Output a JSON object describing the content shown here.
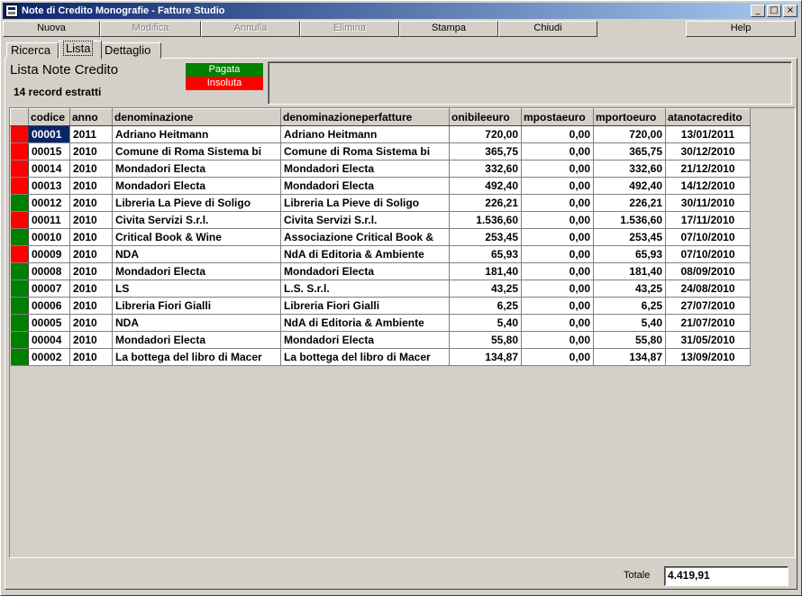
{
  "window": {
    "title": "Note di Credito Monografie - Fatture Studio"
  },
  "toolbar": {
    "nuova": "Nuova",
    "modifica": "Modifica",
    "annulla": "Annulla",
    "elimina": "Elimina",
    "stampa": "Stampa",
    "chiudi": "Chiudi",
    "help": "Help"
  },
  "tabs": [
    "Ricerca",
    "Lista",
    "Dettaglio"
  ],
  "list": {
    "title": "Lista Note Credito",
    "record_count": "14 record estratti"
  },
  "legend": {
    "paid": "Pagata",
    "unpaid": "Insoluta",
    "paid_color": "#008000",
    "unpaid_color": "#ff0000"
  },
  "columns": [
    "codice",
    "anno",
    "denominazione",
    "denominazioneperfatture",
    "onibileeuro",
    "mpostaeuro",
    "mportoeuro",
    "atanotacredito"
  ],
  "rows": [
    {
      "status": "unpaid",
      "codice": "00001",
      "anno": "2011",
      "denominazione": "Adriano Heitmann",
      "denominazioneperfatture": "Adriano Heitmann",
      "imponibile": "720,00",
      "imposta": "0,00",
      "importo": "720,00",
      "data": "13/01/2011"
    },
    {
      "status": "unpaid",
      "codice": "00015",
      "anno": "2010",
      "denominazione": "Comune di Roma Sistema bi",
      "denominazioneperfatture": "Comune di Roma Sistema bi",
      "imponibile": "365,75",
      "imposta": "0,00",
      "importo": "365,75",
      "data": "30/12/2010"
    },
    {
      "status": "unpaid",
      "codice": "00014",
      "anno": "2010",
      "denominazione": "Mondadori Electa",
      "denominazioneperfatture": "Mondadori Electa",
      "imponibile": "332,60",
      "imposta": "0,00",
      "importo": "332,60",
      "data": "21/12/2010"
    },
    {
      "status": "unpaid",
      "codice": "00013",
      "anno": "2010",
      "denominazione": "Mondadori Electa",
      "denominazioneperfatture": "Mondadori Electa",
      "imponibile": "492,40",
      "imposta": "0,00",
      "importo": "492,40",
      "data": "14/12/2010"
    },
    {
      "status": "paid",
      "codice": "00012",
      "anno": "2010",
      "denominazione": "Libreria La Pieve di Soligo",
      "denominazioneperfatture": "Libreria La Pieve di Soligo",
      "imponibile": "226,21",
      "imposta": "0,00",
      "importo": "226,21",
      "data": "30/11/2010"
    },
    {
      "status": "unpaid",
      "codice": "00011",
      "anno": "2010",
      "denominazione": "Civita Servizi S.r.l.",
      "denominazioneperfatture": "Civita Servizi S.r.l.",
      "imponibile": "1.536,60",
      "imposta": "0,00",
      "importo": "1.536,60",
      "data": "17/11/2010"
    },
    {
      "status": "paid",
      "codice": "00010",
      "anno": "2010",
      "denominazione": "Critical Book & Wine",
      "denominazioneperfatture": "Associazione Critical Book &",
      "imponibile": "253,45",
      "imposta": "0,00",
      "importo": "253,45",
      "data": "07/10/2010"
    },
    {
      "status": "unpaid",
      "codice": "00009",
      "anno": "2010",
      "denominazione": "NDA",
      "denominazioneperfatture": "NdA di Editoria & Ambiente",
      "imponibile": "65,93",
      "imposta": "0,00",
      "importo": "65,93",
      "data": "07/10/2010"
    },
    {
      "status": "paid",
      "codice": "00008",
      "anno": "2010",
      "denominazione": "Mondadori Electa",
      "denominazioneperfatture": "Mondadori Electa",
      "imponibile": "181,40",
      "imposta": "0,00",
      "importo": "181,40",
      "data": "08/09/2010"
    },
    {
      "status": "paid",
      "codice": "00007",
      "anno": "2010",
      "denominazione": "LS",
      "denominazioneperfatture": "L.S. S.r.l.",
      "imponibile": "43,25",
      "imposta": "0,00",
      "importo": "43,25",
      "data": "24/08/2010"
    },
    {
      "status": "paid",
      "codice": "00006",
      "anno": "2010",
      "denominazione": "Libreria Fiori Gialli",
      "denominazioneperfatture": "Libreria Fiori Gialli",
      "imponibile": "6,25",
      "imposta": "0,00",
      "importo": "6,25",
      "data": "27/07/2010"
    },
    {
      "status": "paid",
      "codice": "00005",
      "anno": "2010",
      "denominazione": "NDA",
      "denominazioneperfatture": "NdA di Editoria & Ambiente",
      "imponibile": "5,40",
      "imposta": "0,00",
      "importo": "5,40",
      "data": "21/07/2010"
    },
    {
      "status": "paid",
      "codice": "00004",
      "anno": "2010",
      "denominazione": "Mondadori Electa",
      "denominazioneperfatture": "Mondadori Electa",
      "imponibile": "55,80",
      "imposta": "0,00",
      "importo": "55,80",
      "data": "31/05/2010"
    },
    {
      "status": "paid",
      "codice": "00002",
      "anno": "2010",
      "denominazione": "La bottega del libro di Macer",
      "denominazioneperfatture": "La bottega del libro di Macer",
      "imponibile": "134,87",
      "imposta": "0,00",
      "importo": "134,87",
      "data": "13/09/2010"
    }
  ],
  "footer": {
    "total_label": "Totale",
    "total_value": "4.419,91"
  }
}
